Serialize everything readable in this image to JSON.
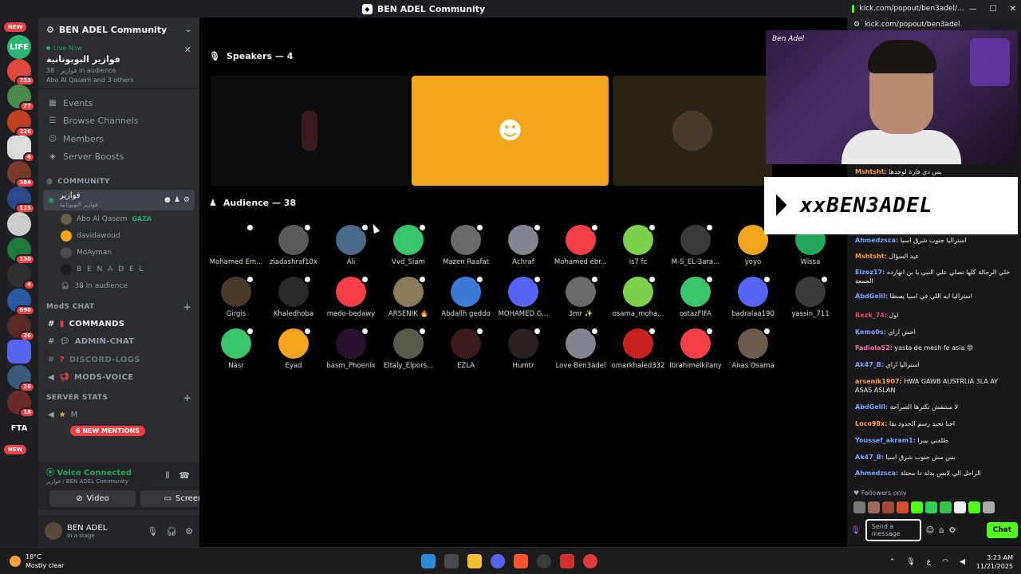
{
  "window": {
    "title": "BEN ADEL Community"
  },
  "rail": {
    "new_top": "NEW",
    "new_bottom": "NEW",
    "fta_label": "FTA",
    "life_label": "LIFE",
    "badges": [
      "733",
      "77",
      "226",
      "6",
      "384",
      "115",
      "130",
      "4",
      "690",
      "26",
      "16",
      "18"
    ]
  },
  "sidebar": {
    "server_name": "BEN ADEL Community",
    "live": {
      "status": "Live Now",
      "title": "فوازير البوبونانية",
      "meta": "فوازير · 38 in audience",
      "participants": "Abo Al Qasem and 3 others"
    },
    "nav": [
      {
        "label": "Events",
        "icon": "calendar-icon"
      },
      {
        "label": "Browse Channels",
        "icon": "list-icon"
      },
      {
        "label": "Members",
        "icon": "members-icon"
      },
      {
        "label": "Server Boosts",
        "icon": "boost-icon"
      }
    ],
    "community_category": "COMMUNITY",
    "stage_channel": {
      "name": "فوازير",
      "sub": "فوازير البوبونانية"
    },
    "stage_users": [
      {
        "name": "Abo Al Qasem",
        "tag": "GAZA",
        "color": "#6b5a48"
      },
      {
        "name": "davidawoud",
        "tag": "",
        "color": "#f0a51c"
      },
      {
        "name": "MoAyman",
        "tag": "",
        "color": "#4a4a4a"
      },
      {
        "name": "B E N A D E L",
        "tag": "",
        "color": "#2b2d31"
      }
    ],
    "audience_count": "38 in audience",
    "mods_category": "ModS CHAT",
    "mod_channels": [
      {
        "name": "COMMANDS",
        "icon": "notebook-icon",
        "highlight": true
      },
      {
        "name": "ADMIN-CHAT",
        "icon": "chat-icon",
        "highlight": false
      },
      {
        "name": "DISCORD-LOGS",
        "icon": "question-icon",
        "highlight": false
      },
      {
        "name": "MODS-VOICE",
        "icon": "megaphone-icon",
        "highlight": false
      }
    ],
    "stats_category": "SERVER STATS",
    "stats_item": "M",
    "mentions_pill": "6 NEW MENTIONS"
  },
  "voice": {
    "status": "Voice Connected",
    "sub": "فوازير / BEN ADEL Community",
    "video_label": "Video",
    "screen_label": "Screen"
  },
  "user": {
    "name": "BEN ADEL",
    "status": "In a stage"
  },
  "stage": {
    "speakers_title": "Speakers — 4",
    "audience_title": "Audience — 38",
    "audience": [
      {
        "name": "Mohamed Em...",
        "color": "#000000"
      },
      {
        "name": "ziadashraf10x",
        "color": "#5a5a5a"
      },
      {
        "name": "Ali",
        "color": "#4b6a8a"
      },
      {
        "name": "Vvd_Siam",
        "color": "#39c46b"
      },
      {
        "name": "Mazen Raafat",
        "color": "#6a6a6a"
      },
      {
        "name": "Achraf",
        "color": "#80848e"
      },
      {
        "name": "Mohamed ebr...",
        "color": "#f23f43"
      },
      {
        "name": "is7 fc",
        "color": "#7bd14c"
      },
      {
        "name": "M-S_EL-3ara...",
        "color": "#3a3a3a"
      },
      {
        "name": "yoyo",
        "color": "#f0a51c"
      },
      {
        "name": "Wissa",
        "color": "#23a55a"
      },
      {
        "name": "Girgis",
        "color": "#4a3a2a"
      },
      {
        "name": "Khaledhoba",
        "color": "#2a2a2a"
      },
      {
        "name": "medo-bedawy",
        "color": "#f23f43"
      },
      {
        "name": "ARSENIK 🔥",
        "color": "#8a7a5a"
      },
      {
        "name": "Abdallh geddo",
        "color": "#3b7bd6"
      },
      {
        "name": "MOHAMED G...",
        "color": "#5865f2"
      },
      {
        "name": "3mr ✨",
        "color": "#6a6a6a"
      },
      {
        "name": "osama_moha...",
        "color": "#7bd14c"
      },
      {
        "name": "ostazFIFA",
        "color": "#39c46b"
      },
      {
        "name": "badralaa190",
        "color": "#5865f2"
      },
      {
        "name": "yassin_711",
        "color": "#3a3a3a"
      },
      {
        "name": "Nasr",
        "color": "#39c46b"
      },
      {
        "name": "Eyad",
        "color": "#f0a51c"
      },
      {
        "name": "basm_Phoenix",
        "color": "#2a1030"
      },
      {
        "name": "Eltaly_Elpors...",
        "color": "#5a5a4a"
      },
      {
        "name": "EZLA",
        "color": "#3a1a1a"
      },
      {
        "name": "Humtr",
        "color": "#2a2020"
      },
      {
        "name": "Love Ben3adel",
        "color": "#80848e"
      },
      {
        "name": "omarkhaled332",
        "color": "#c92020"
      },
      {
        "name": "Ibrahimelkilany",
        "color": "#f23f43"
      },
      {
        "name": "Anas Osama",
        "color": "#6a5a4a"
      }
    ]
  },
  "browser": {
    "title": "kick.com/popout/ben3adel/...",
    "url": "kick.com/popout/ben3adel"
  },
  "overlay": {
    "signature": "Ben Adel",
    "banner_text": "xxBEN3ADEL"
  },
  "chat": {
    "messages": [
      {
        "user": "Mshtsht:",
        "text": "بس دي فارة لوحدها",
        "color": "#ff9f43"
      },
      {
        "user": "Ahmedzsca:",
        "text": "استراليا جنوب شرق اسيا",
        "color": "#7aa2ff"
      },
      {
        "user": "Mshtsht:",
        "text": "عيد السؤال",
        "color": "#ff9f43"
      },
      {
        "user": "Elzoz17:",
        "text": "خلي الرجالة كلها تصلي علي النبي يا بن انهارده الجمعة",
        "color": "#7aa2ff"
      },
      {
        "user": "AbdGelil:",
        "text": "استراليا ايه اللي في اسيا يسطا",
        "color": "#7aa2ff"
      },
      {
        "user": "Rezk_74:",
        "text": "اول",
        "color": "#e05050"
      },
      {
        "user": "Kemo0s:",
        "text": "اخش ازاي",
        "color": "#7aa2ff"
      },
      {
        "user": "Fadiola52:",
        "text": "yasta de mesh fe asia 😡",
        "color": "#ff6fae"
      },
      {
        "user": "Ak47_B:",
        "text": "استراليا ازاي",
        "color": "#7aa2ff"
      },
      {
        "user": "arsenik1907:",
        "text": "HWA GAWB AUSTRLIA 3LA AY ASAS ASLAN",
        "color": "#ff9f43"
      },
      {
        "user": "AbdGelil:",
        "text": "لا مبتنفش تكترها الصراحة",
        "color": "#7aa2ff"
      },
      {
        "user": "Loco98x:",
        "text": "احنا نجيد رسم الحدود بقا",
        "color": "#ff9f43"
      },
      {
        "user": "Youssef_akram1:",
        "text": "طلعني بيبرا",
        "color": "#7aa2ff"
      },
      {
        "user": "Ak47_B:",
        "text": "بس مش جنوب شرق اسيا",
        "color": "#7aa2ff"
      },
      {
        "user": "Ahmedzsca:",
        "text": "الراجل الي لابس بدلة دا محتلة",
        "color": "#7aa2ff"
      }
    ],
    "followers_only": "Followers only",
    "input_placeholder": "Send a message",
    "chat_button": "Chat"
  },
  "taskbar": {
    "temp": "18°C",
    "weather": "Mostly clear",
    "time": "3:23 AM",
    "date": "11/21/2025",
    "lang": "ع"
  }
}
